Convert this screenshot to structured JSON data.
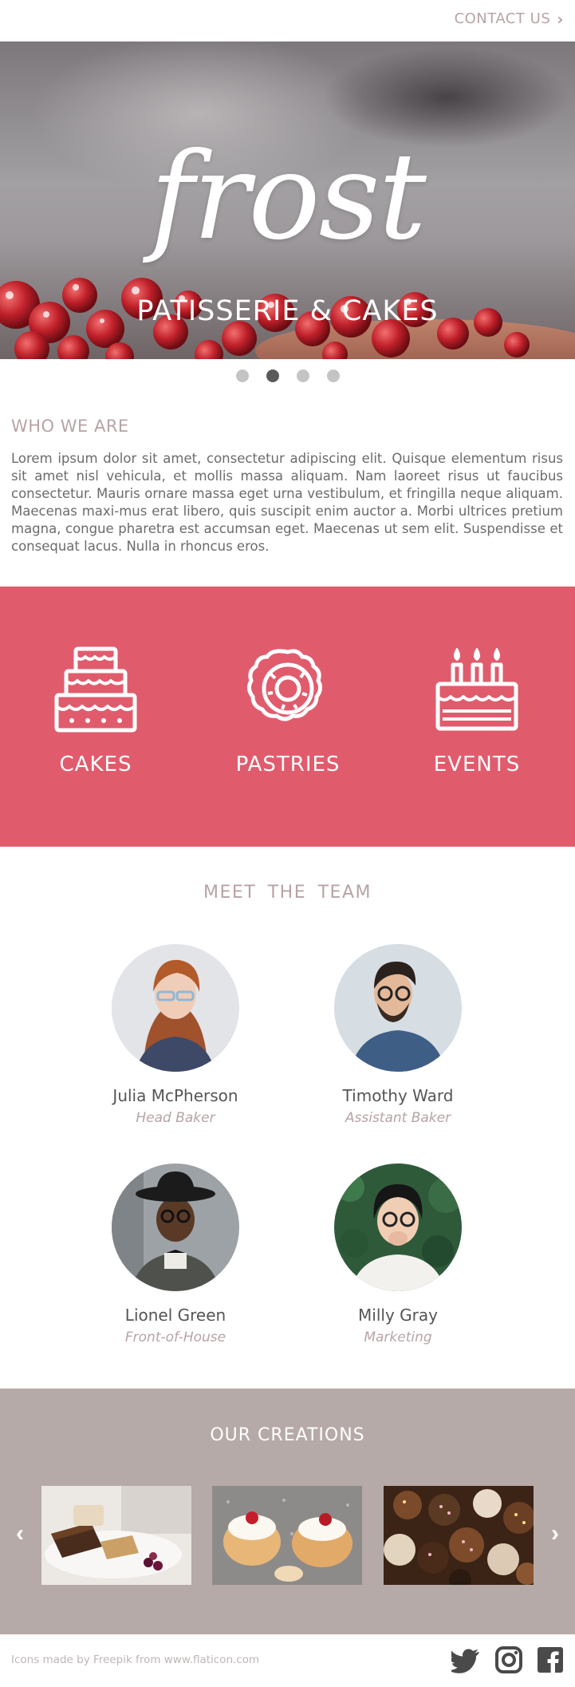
{
  "header": {
    "contact_label": "CONTACT US"
  },
  "hero": {
    "brand": "frost",
    "tagline": "PATISSERIE & CAKES"
  },
  "carousel": {
    "slides": 4,
    "active_index": 1
  },
  "about": {
    "title": "WHO WE ARE",
    "text": "Lorem ipsum dolor sit amet, consectetur adipiscing elit. Quisque elementum risus sit amet nisl vehicula, et mollis massa aliquam. Nam laoreet risus ut faucibus consectetur. Mauris ornare massa eget urna vestibulum, et fringilla neque aliquam. Maecenas maxi-mus erat libero, quis suscipit enim auctor a. Morbi ultrices pretium magna, congue pharetra est accumsan eget. Maecenas ut sem elit. Suspendisse et consequat lacus. Nulla in rhoncus eros."
  },
  "services": {
    "items": [
      {
        "label": "CAKES",
        "icon": "cake-icon"
      },
      {
        "label": "PASTRIES",
        "icon": "donut-icon"
      },
      {
        "label": "EVENTS",
        "icon": "birthday-cake-icon"
      }
    ]
  },
  "team": {
    "title": "MEET  THE TEAM",
    "members": [
      {
        "name": "Julia McPherson",
        "role": "Head Baker"
      },
      {
        "name": "Timothy Ward",
        "role": "Assistant Baker"
      },
      {
        "name": "Lionel Green",
        "role": "Front-of-House"
      },
      {
        "name": "Milly Gray",
        "role": "Marketing"
      }
    ]
  },
  "creations": {
    "title": "OUR CREATIONS"
  },
  "footer": {
    "credit": "Icons made by Freepik from www.flaticon.com",
    "social": [
      "twitter-icon",
      "instagram-icon",
      "facebook-icon"
    ]
  },
  "colors": {
    "accent": "#e05c6d",
    "muted_pink": "#b8a3a6",
    "creations_bg": "#b5aaa7",
    "social_icon": "#4a4a4a"
  }
}
